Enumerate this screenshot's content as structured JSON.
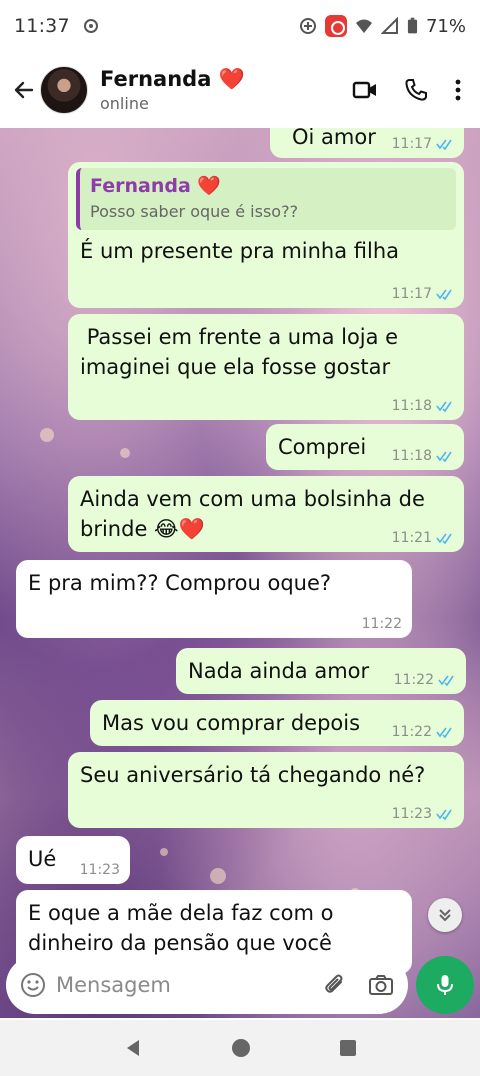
{
  "status_bar": {
    "time": "11:37",
    "battery": "71%"
  },
  "header": {
    "contact_name": "Fernanda ❤️",
    "contact_status": "online"
  },
  "messages": [
    {
      "id": "m1",
      "text": "Oi amor",
      "time": "11:17"
    },
    {
      "id": "m2",
      "quote_name": "Fernanda ❤️",
      "quote_text": "Posso saber oque é isso??",
      "text": "É um presente pra minha filha",
      "time": "11:17"
    },
    {
      "id": "m3",
      "text": " Passei em frente a uma loja e\nimaginei que ela fosse gostar",
      "time": "11:18"
    },
    {
      "id": "m4",
      "text": "Comprei",
      "time": "11:18"
    },
    {
      "id": "m5",
      "text": "Ainda vem com uma bolsinha de\nbrinde 😂❤️",
      "time": "11:21"
    },
    {
      "id": "m6",
      "text": "E pra mim?? Comprou oque?",
      "time": "11:22"
    },
    {
      "id": "m7",
      "text": "Nada ainda amor",
      "time": "11:22"
    },
    {
      "id": "m8",
      "text": "Mas vou comprar depois",
      "time": "11:22"
    },
    {
      "id": "m9",
      "text": "Seu aniversário tá chegando né?",
      "time": "11:23"
    },
    {
      "id": "m10",
      "text": "Ué",
      "time": "11:23"
    },
    {
      "id": "m11",
      "text": "E oque a mãe dela faz com o\ndinheiro da pensão que você",
      "time": ""
    }
  ],
  "composer": {
    "placeholder": "Mensagem"
  },
  "colors": {
    "outgoing_bubble": "#e7fdd7",
    "incoming_bubble": "#ffffff",
    "accent_green": "#1daa61",
    "read_ticks": "#4fb6ec",
    "quote_accent": "#8e3da8"
  }
}
